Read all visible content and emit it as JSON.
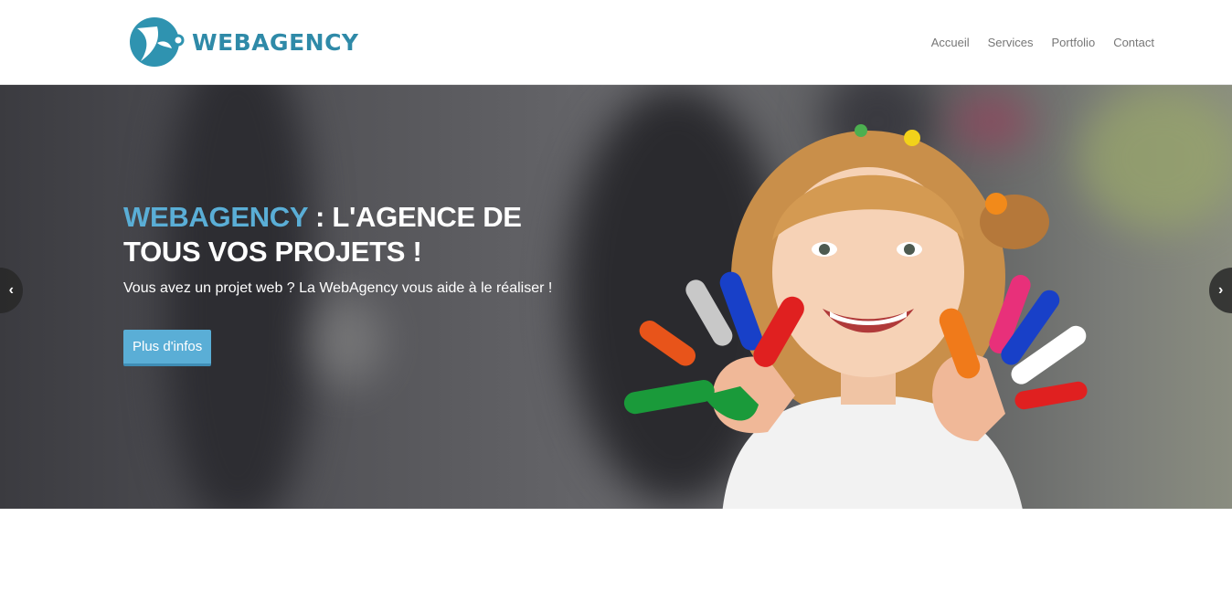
{
  "logo": {
    "text": "WEBAGENCY",
    "icon": "webagency-logo-icon",
    "color": "#2f8aa8"
  },
  "nav": {
    "items": [
      {
        "label": "Accueil"
      },
      {
        "label": "Services"
      },
      {
        "label": "Portfolio"
      },
      {
        "label": "Contact"
      }
    ]
  },
  "hero": {
    "title_accent": "WEBAGENCY",
    "title_rest": " : L'AGENCE DE TOUS VOS PROJETS !",
    "subtitle": "Vous avez un projet web ? La WebAgency vous aide à le réaliser !",
    "button_label": "Plus d'infos",
    "accent_color": "#5aaed6",
    "prev_icon": "chevron-left-icon",
    "next_icon": "chevron-right-icon",
    "prev_glyph": "‹",
    "next_glyph": "›"
  }
}
